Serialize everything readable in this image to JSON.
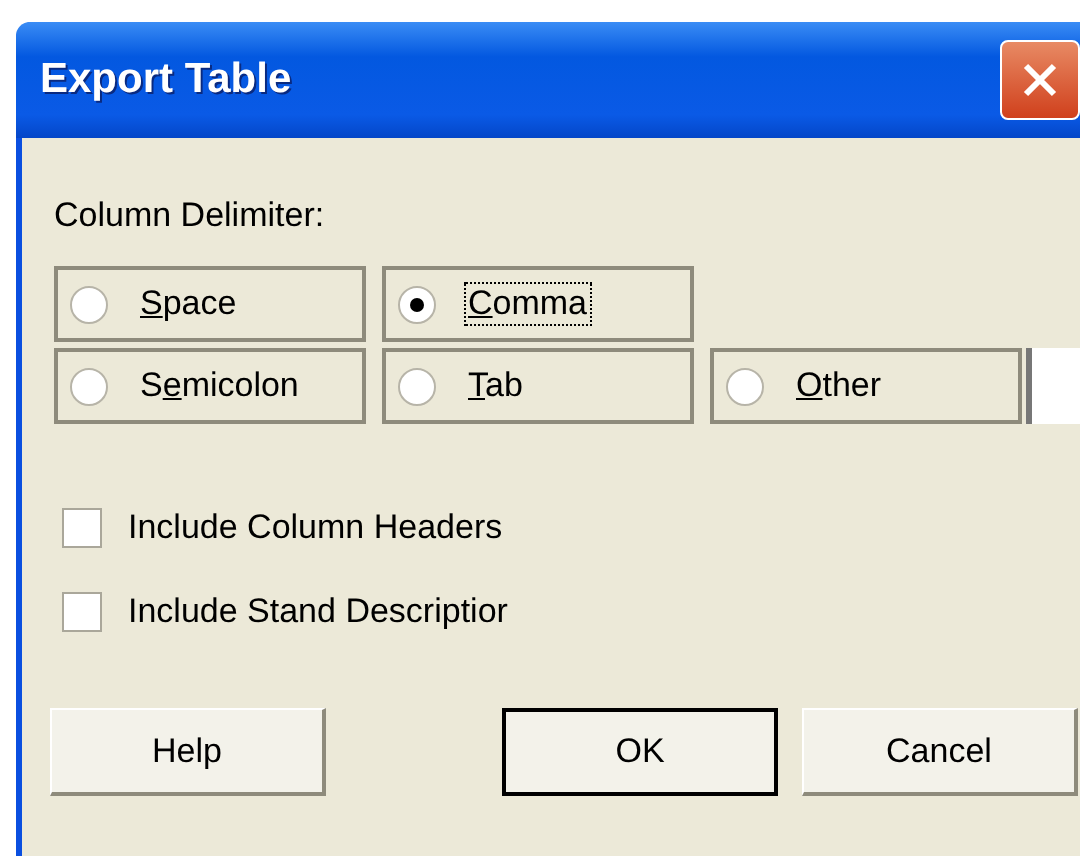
{
  "window": {
    "title": "Export Table"
  },
  "delimiter": {
    "label": "Column Delimiter:",
    "options": [
      {
        "key": "S",
        "post": "pace",
        "selected": false,
        "focused": false
      },
      {
        "key": "C",
        "post": "omma",
        "selected": true,
        "focused": true
      },
      {
        "pre": "S",
        "key": "e",
        "post": "micolon",
        "selected": false,
        "focused": false
      },
      {
        "key": "T",
        "post": "ab",
        "selected": false,
        "focused": false
      },
      {
        "key": "O",
        "post": "ther",
        "selected": false,
        "focused": false
      }
    ]
  },
  "checkboxes": [
    {
      "label": "Include Column Headers",
      "checked": false
    },
    {
      "label": "Include Stand Descriptior",
      "checked": false
    }
  ],
  "buttons": [
    {
      "label": "Help",
      "default": false
    },
    {
      "label": "OK",
      "default": true
    },
    {
      "label": "Cancel",
      "default": false
    }
  ]
}
